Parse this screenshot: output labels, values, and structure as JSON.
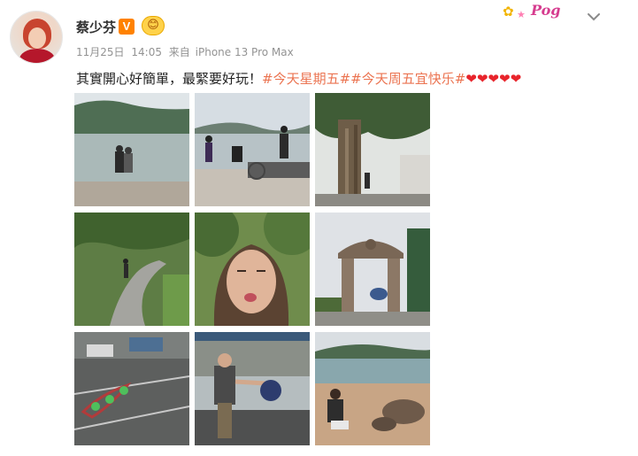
{
  "post": {
    "username": "蔡少芬",
    "vip_label": "V",
    "badge_emoji": "😊",
    "date": "11月25日",
    "time": "14:05",
    "source_prefix": "来自",
    "source_device": "iPhone 13 Pro Max",
    "text": "其實開心好簡單，最緊要好玩！",
    "hashtags": [
      "#今天星期五#",
      "#今天周五宜快乐#"
    ],
    "hearts": "❤❤❤❤❤",
    "sticker_text": "Pog"
  },
  "photos": [
    {
      "id": "couple-on-seawall"
    },
    {
      "id": "people-at-pier"
    },
    {
      "id": "banyan-tree-path"
    },
    {
      "id": "person-on-trail"
    },
    {
      "id": "kissing-face-selfie"
    },
    {
      "id": "stone-archway"
    },
    {
      "id": "hopscotch-ground"
    },
    {
      "id": "man-playing-with-child"
    },
    {
      "id": "man-at-beach-rocks"
    }
  ],
  "icons": {
    "menu": "chevron-down-icon"
  },
  "colors": {
    "hashtag": "#eb7350",
    "meta": "#939393",
    "vip": "#ff8200",
    "heart": "#e8242b"
  }
}
